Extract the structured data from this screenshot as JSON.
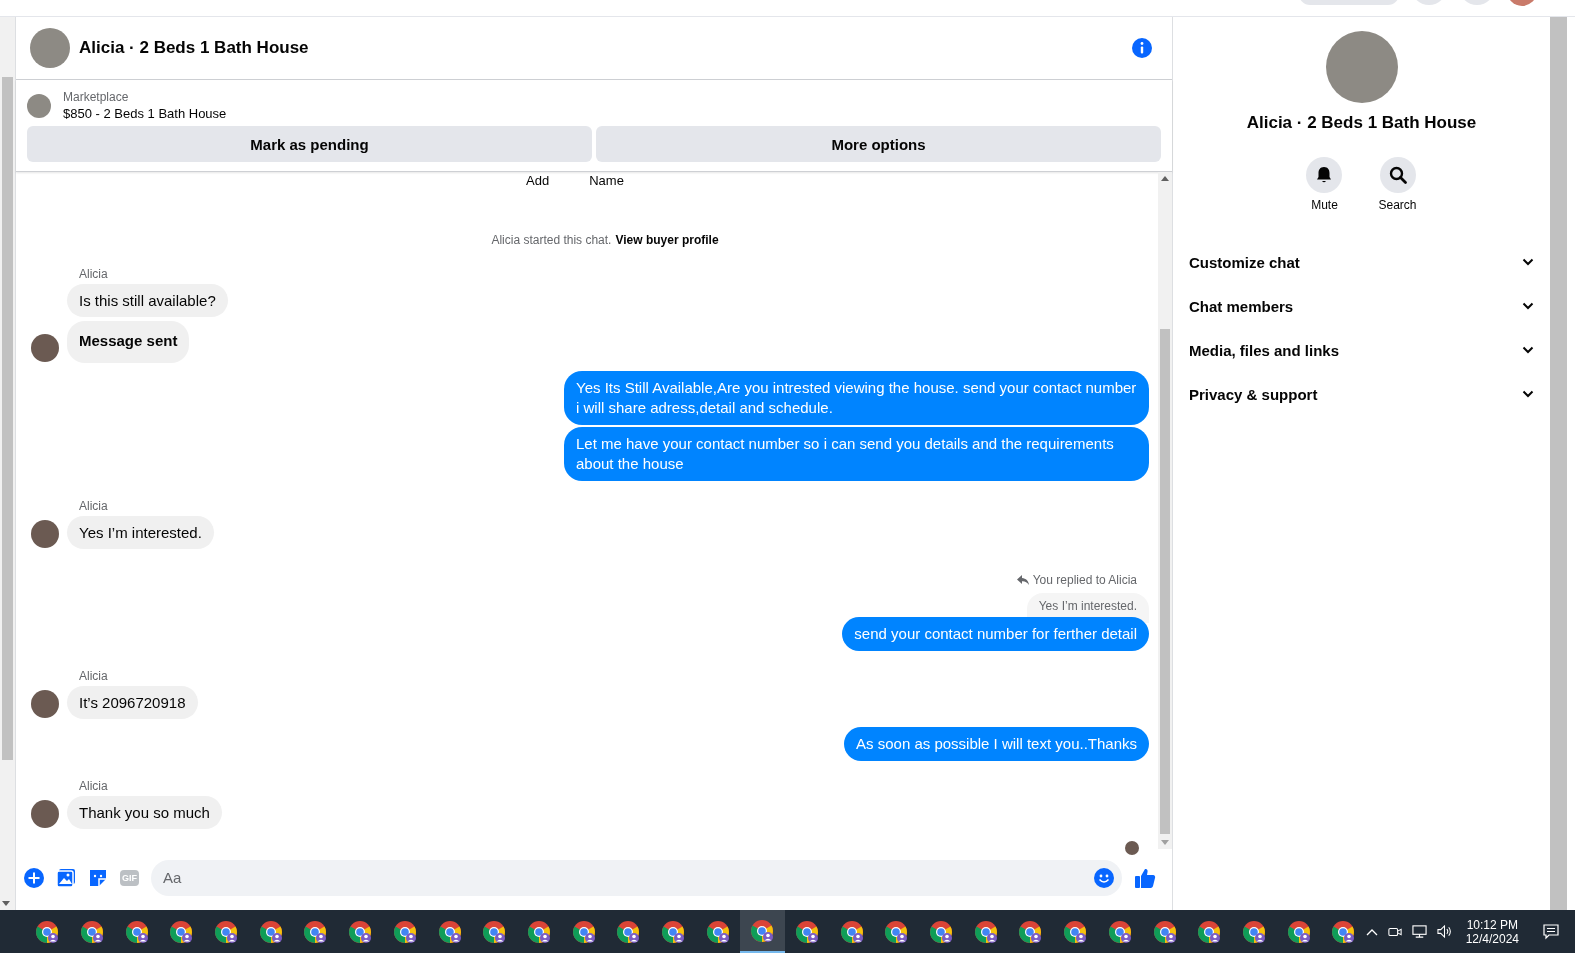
{
  "header": {
    "title": "Alicia · 2 Beds 1 Bath House"
  },
  "listing": {
    "source": "Marketplace",
    "title": "$850 - 2 Beds 1 Bath House",
    "buttons": [
      "Mark as pending",
      "More options"
    ]
  },
  "chat": {
    "top_labels": [
      "Add",
      "Name"
    ],
    "notice": {
      "text": "Alicia started this chat.",
      "link": "View buyer profile"
    },
    "groups": [
      {
        "kind": "incoming",
        "sender": "Alicia",
        "messages": [
          {
            "text": "Is this still available?",
            "bold": false
          },
          {
            "text": "Message sent",
            "bold": true
          }
        ]
      },
      {
        "kind": "outgoing",
        "messages": [
          {
            "text": "Yes Its Still Available,Are you intrested viewing the house. send your contact number i will share adress,detail and schedule.",
            "bold": false
          },
          {
            "text": "Let me have your contact number so i can send you details and the requirements about the house",
            "bold": false
          }
        ]
      },
      {
        "kind": "incoming",
        "sender": "Alicia",
        "messages": [
          {
            "text": "Yes I’m interested.",
            "bold": false
          }
        ]
      },
      {
        "kind": "outgoing",
        "reply": {
          "label": "You replied to Alicia",
          "quote": "Yes I’m interested."
        },
        "messages": [
          {
            "text": "send your contact number for ferther detail",
            "bold": false
          }
        ]
      },
      {
        "kind": "incoming",
        "sender": "Alicia",
        "messages": [
          {
            "text": "It’s 2096720918",
            "bold": false
          }
        ]
      },
      {
        "kind": "outgoing",
        "messages": [
          {
            "text": "As soon as possible I will text you..Thanks",
            "bold": false
          }
        ]
      },
      {
        "kind": "incoming",
        "sender": "Alicia",
        "messages": [
          {
            "text": "Thank you so much",
            "bold": false
          }
        ]
      }
    ]
  },
  "composer": {
    "gif_label": "GIF",
    "placeholder": "Aa"
  },
  "details": {
    "title": "Alicia · 2 Beds 1 Bath House",
    "actions": [
      {
        "kind": "mute",
        "label": "Mute"
      },
      {
        "kind": "search",
        "label": "Search"
      }
    ],
    "sections": [
      {
        "label": "Customize chat",
        "expanded": false
      },
      {
        "label": "Chat members",
        "expanded": false
      },
      {
        "label": "Media, files and links",
        "expanded": false
      },
      {
        "label": "Privacy & support",
        "expanded": false
      }
    ]
  },
  "taskbar": {
    "apps": [
      {
        "selected": false
      },
      {
        "selected": false
      },
      {
        "selected": false
      },
      {
        "selected": false
      },
      {
        "selected": false
      },
      {
        "selected": false
      },
      {
        "selected": false
      },
      {
        "selected": false
      },
      {
        "selected": false
      },
      {
        "selected": false
      },
      {
        "selected": false
      },
      {
        "selected": false
      },
      {
        "selected": false
      },
      {
        "selected": false
      },
      {
        "selected": false
      },
      {
        "selected": false
      },
      {
        "selected": true
      },
      {
        "selected": false
      },
      {
        "selected": false
      },
      {
        "selected": false
      },
      {
        "selected": false
      },
      {
        "selected": false
      },
      {
        "selected": false
      },
      {
        "selected": false
      },
      {
        "selected": false
      },
      {
        "selected": false
      },
      {
        "selected": false
      },
      {
        "selected": false
      },
      {
        "selected": false
      },
      {
        "selected": false
      }
    ],
    "time": "10:12 PM",
    "date": "12/4/2024"
  }
}
